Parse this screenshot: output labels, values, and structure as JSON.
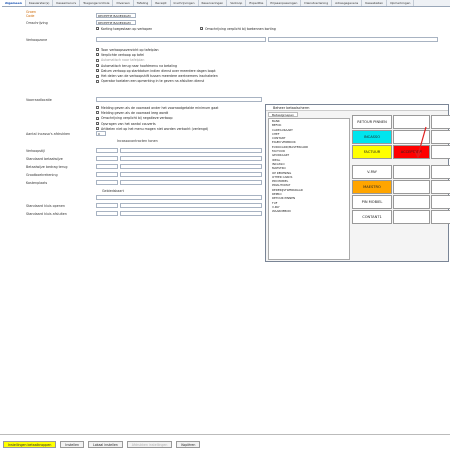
{
  "tabs": [
    "Algemeen",
    "Kassierster(s)",
    "Kassamenu's",
    "Toegangscontrole",
    "Diversen",
    "Tafeling",
    "Receipt",
    "Inschrijvingen",
    "Reserveringen",
    "Verkoop",
    "Expeditie",
    "Prijsaanpassingen",
    "Dienstverlening",
    "Adresgegevens",
    "Kassaballen",
    "Opmerkingen"
  ],
  "fields": {
    "code_label": "Code",
    "code_value": "RECEPTIE BADERDAM",
    "code_marker": "Groen",
    "omschrijving_label": "Omschrijving",
    "omschrijving_value": "RECEPTIE BADERDAM",
    "korting_label": "Korting toegestaan op verkopen",
    "omschrijving_verplicht_label": "Omschrijving verplicht bij toekennen korting",
    "verkoopzone_label": "Verkoopzone",
    "voorraadlocatie_label": "Voorraadlocatie",
    "aantal_label": "Aantal incasso's afdrukken",
    "aantal_value": "0",
    "incasso_label": "Incassocontracten tonen",
    "verkoopstijl_label": "Verkoopstijl",
    "standaard_label": "Standaard betaalwijze",
    "betaalwijze_label": "Betaalwijze bedrag terug",
    "grootboek_label": "Grootboekrekening",
    "kostenplaats_label": "Kostenplaats",
    "gebiedskaart_label": "Gebiedskaart",
    "kluis_openen_label": "Standaard kluis openen",
    "kluis_sluiten_label": "Standaard kluis afsluiten"
  },
  "options1": [
    {
      "label": "Toon verkoopsoverzicht op tafelplan",
      "checked": false,
      "disabled": false
    },
    {
      "label": "Verplichte verkoop op tafel",
      "checked": true,
      "disabled": false
    },
    {
      "label": "Automatisch naar tafelplan",
      "checked": false,
      "disabled": true
    },
    {
      "label": "Automatisch terug naar hoofdmenu na betaling",
      "checked": true,
      "disabled": false
    },
    {
      "label": "Datum verkoop op startdatum indien dienst over meerdere dagen loopt",
      "checked": true,
      "disabled": false
    },
    {
      "label": "Het delen van de verkoopshift tussen meerdere werknemers inschakelen",
      "checked": false,
      "disabled": false
    },
    {
      "label": "Operator toelaten een opmerking in te geven na afsluiten dienst",
      "checked": false,
      "disabled": false
    }
  ],
  "options2": [
    {
      "label": "Melding geven als de voorraad onder het voorraadgetalde minimum gaat",
      "checked": false
    },
    {
      "label": "Melding geven als de voorraad leeg wordt",
      "checked": false
    },
    {
      "label": "Omschrijving verplicht bij negatieve verkoop",
      "checked": true
    },
    {
      "label": "Opvragen van het aantal couverts",
      "checked": true
    },
    {
      "label": "Artikelen niet op het menu mogen niet worden verkocht (verlengd)",
      "checked": false
    }
  ],
  "panel": {
    "title": "Beheer betaalscherm",
    "tab": "Betaalgroepen",
    "list": [
      "BANK",
      "BEFOK",
      "CADEAUKAART",
      "CHEF",
      "CONTANT",
      "EIGEN VERBRUIK",
      "EUROCARD/MASTERCARD",
      "FACTUUR",
      "GEURKAART",
      "IDEAL",
      "INCASSO",
      "MAESTRO",
      "OP REKENING",
      "OTHER CARDS",
      "PIN MOBIEL",
      "PINAUTOMAT",
      "REDERIJSTWERKRAAD",
      "REPRO",
      "RETOUR PINNEN",
      "TUF",
      "V-PAY",
      "WAARDEBON"
    ],
    "buttons": [
      [
        {
          "label": "RETOUR PINNEN",
          "bg": "#ffffff"
        },
        {
          "label": "",
          "bg": "#ffffff"
        },
        {
          "label": "",
          "bg": "#ffffff"
        }
      ],
      [
        {
          "label": "INCASSO",
          "bg": "#00e5ee"
        },
        {
          "label": "",
          "bg": "#ffffff"
        },
        {
          "label": "",
          "bg": "#ffffff"
        }
      ],
      [
        {
          "label": "FACTUUR",
          "bg": "#ffff00"
        },
        {
          "label": "ACCEPTATIE",
          "bg": "#ff0000"
        },
        {
          "label": "",
          "bg": "#ffffff"
        }
      ],
      [
        {
          "label": "V-PAY",
          "bg": "#ffffff"
        },
        {
          "label": "",
          "bg": "#ffffff"
        },
        {
          "label": "",
          "bg": "#ffffff"
        }
      ],
      [
        {
          "label": "MAESTRO",
          "bg": "#ffa500"
        },
        {
          "label": "",
          "bg": "#ffffff"
        },
        {
          "label": "",
          "bg": "#ffffff"
        }
      ],
      [
        {
          "label": "PIN MOBIEL",
          "bg": "#ffffff"
        },
        {
          "label": "",
          "bg": "#ffffff"
        },
        {
          "label": "",
          "bg": "#ffffff"
        }
      ],
      [
        {
          "label": "CONTANT1",
          "bg": "#ffffff"
        },
        {
          "label": "",
          "bg": "#ffffff"
        },
        {
          "label": "",
          "bg": "#ffffff"
        }
      ]
    ]
  },
  "bottom_buttons": [
    {
      "label": "Instellingen betaalknoppen",
      "highlight": true
    },
    {
      "label": "Instellen",
      "highlight": false
    },
    {
      "label": "Lokaal instellen",
      "highlight": false
    },
    {
      "label": "Afdrukken instellingen",
      "highlight": false,
      "disabled": true
    },
    {
      "label": "Kopiëren",
      "highlight": false
    }
  ],
  "colors": {
    "accent": "#0645ad",
    "arrow": "#e02020",
    "highlight": "#ffff00"
  }
}
